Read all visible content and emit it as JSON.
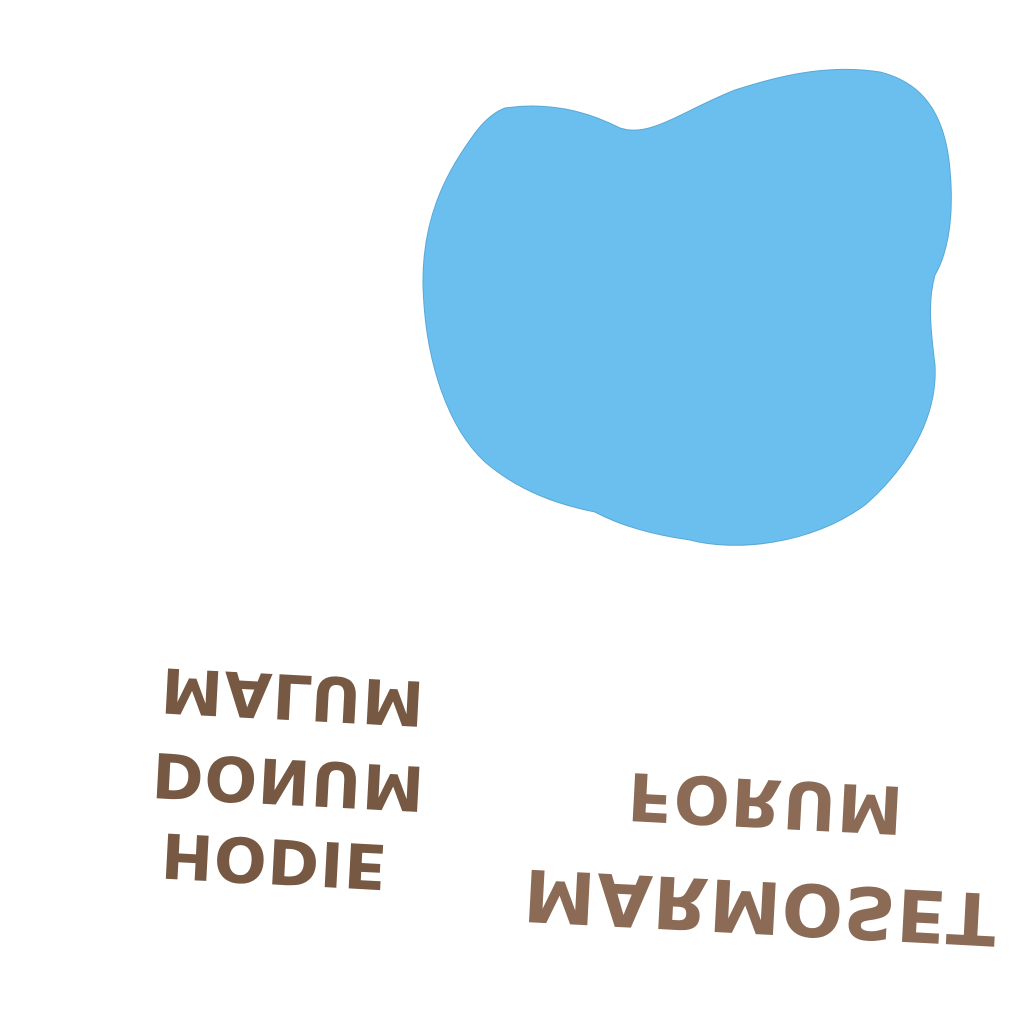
{
  "map": {
    "background_color": "#ffffff",
    "water_color": "#6abfee",
    "water_stroke": "#5aa8d6",
    "label_color_dark": "#765843",
    "label_color_light": "#8c6b56",
    "labels": {
      "malum": "MALUM",
      "donum": "DONUM",
      "hodie": "HODIE",
      "forum": "FORUM",
      "marmoset": "MARMOSET"
    },
    "orientation": "mirrored-upside-down"
  }
}
